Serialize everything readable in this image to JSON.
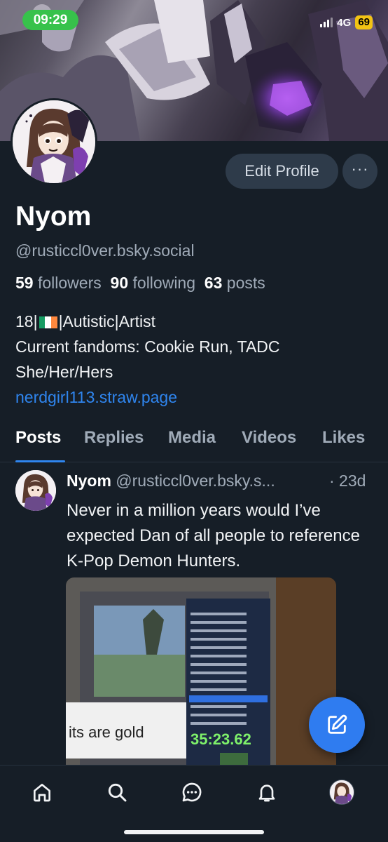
{
  "status_bar": {
    "time": "09:29",
    "network": "4G",
    "battery": "69"
  },
  "profile": {
    "edit_label": "Edit Profile",
    "more_label": "···",
    "name": "Nyom",
    "handle": "@rusticcl0ver.bsky.social",
    "followers_count": "59",
    "followers_label": "followers",
    "following_count": "90",
    "following_label": "following",
    "posts_count": "63",
    "posts_label": "posts",
    "bio_age": "18|",
    "bio_rest": "|Autistic|Artist",
    "bio_line2": "Current fandoms: Cookie Run, TADC",
    "bio_line3": "She/Her/Hers",
    "bio_link": "nerdgirl113.straw.page",
    "flag_colors": [
      "#169b62",
      "#ffffff",
      "#ff883e"
    ]
  },
  "tabs": [
    {
      "label": "Posts"
    },
    {
      "label": "Replies"
    },
    {
      "label": "Media"
    },
    {
      "label": "Videos"
    },
    {
      "label": "Likes"
    }
  ],
  "post": {
    "author": "Nyom",
    "handle": "@rusticcl0ver.bsky.s...",
    "time": "· 23d",
    "text": "Never in a million years would I’ve expected Dan of all people to reference K-Pop Demon Hunters.",
    "media_caption": "its are gold",
    "media_timer": "35:23.62"
  },
  "nav": {
    "icons": [
      "home-icon",
      "search-icon",
      "chat-icon",
      "bell-icon",
      "profile-avatar"
    ]
  },
  "colors": {
    "background": "#161e27",
    "accent": "#2f85ee",
    "button": "#2e3b4a",
    "status_green": "#37c24b",
    "battery_yellow": "#f2c314"
  }
}
